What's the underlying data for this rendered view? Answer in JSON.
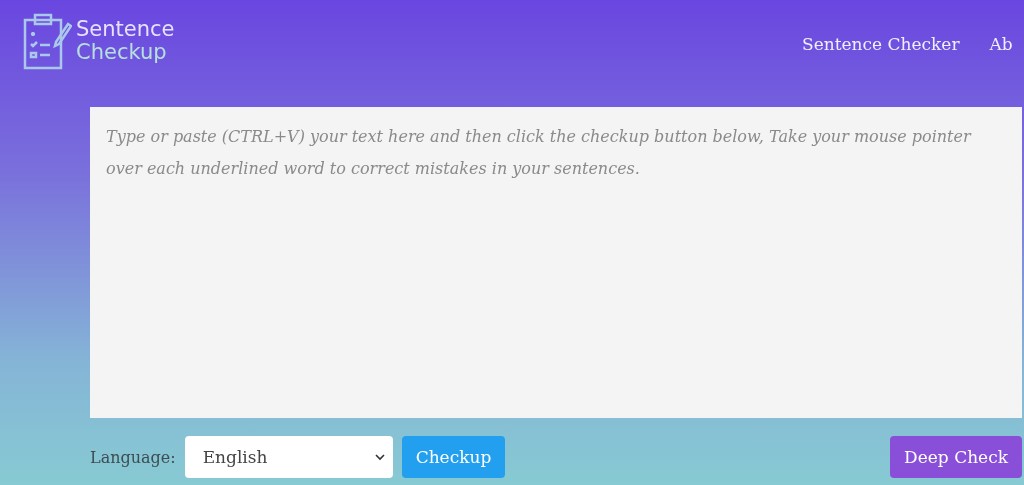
{
  "header": {
    "logo": {
      "line_1": "Sentence",
      "line_2": "Checkup"
    },
    "nav": [
      "Sentence Checker",
      "Ab"
    ]
  },
  "editor": {
    "placeholder": "Type or paste (CTRL+V) your text here and then click the checkup button below, Take your mouse pointer over each underlined word to correct mistakes in your sentences."
  },
  "controls": {
    "language_label": "Language:",
    "language_value": "English",
    "checkup_button": "Checkup",
    "deep_check_button": "Deep Check"
  }
}
